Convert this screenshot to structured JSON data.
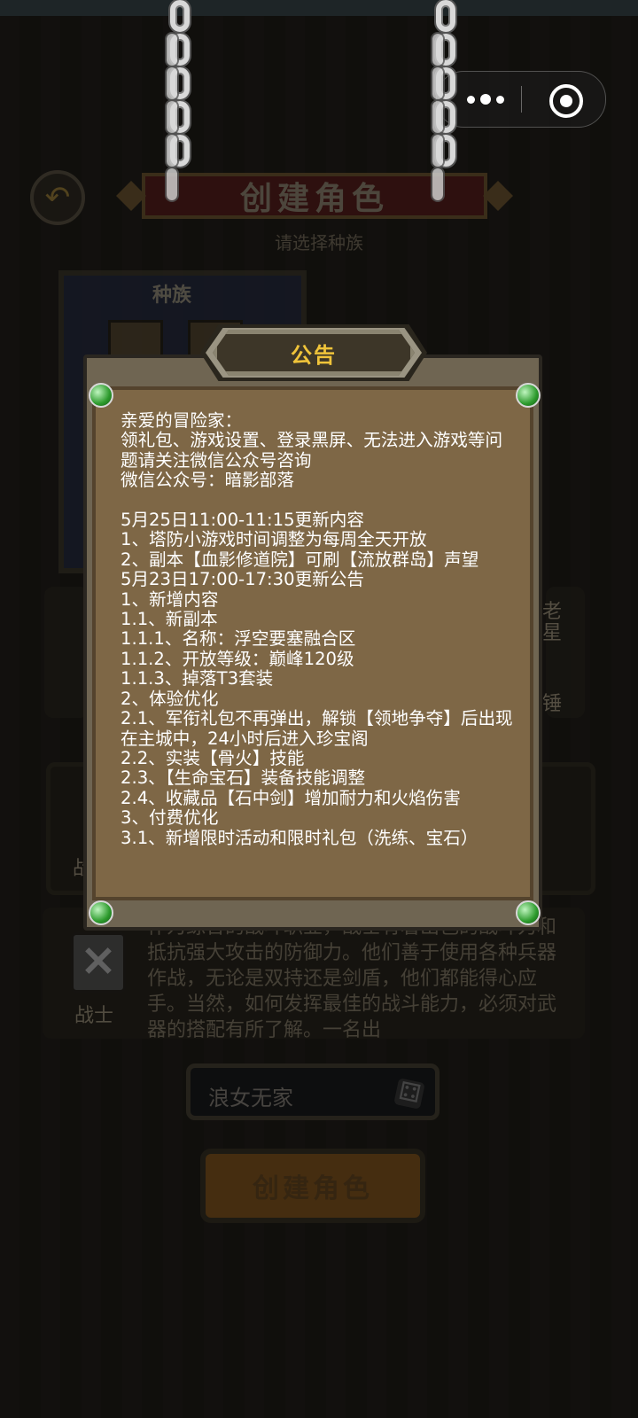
{
  "screen": {
    "title": "创建角色",
    "subtitle": "请选择种族",
    "race_banner_title": "种族",
    "side_right_top": "老",
    "side_right_mid": "星",
    "side_right_bottom": "锤",
    "class_label": "战",
    "warrior_label": "战士",
    "description": "作为综合的战斗职业，战士有着出色的战斗力和抵抗强大攻击的防御力。他们善于使用各种兵器作战，无论是双持还是剑盾，他们都能得心应手。当然，如何发挥最佳的战斗能力，必须对武器的搭配有所了解。一名出",
    "name_value": "浪女无家",
    "create_button": "创建角色"
  },
  "icons": {
    "back": "undo-arrow-icon",
    "more": "more-dots-icon",
    "close": "target-close-icon",
    "dice": "dice-icon",
    "warrior": "crossed-swords-icon"
  },
  "notice": {
    "title": "公告",
    "body": "亲爱的冒险家：\n领礼包、游戏设置、登录黑屏、无法进入游戏等问题请关注微信公众号咨询\n微信公众号：暗影部落\n\n5月25日11:00-11:15更新内容\n1、塔防小游戏时间调整为每周全天开放\n2、副本【血影修道院】可刷【流放群岛】声望\n5月23日17:00-17:30更新公告\n1、新增内容\n1.1、新副本\n1.1.1、名称：浮空要塞融合区\n1.1.2、开放等级：巅峰120级\n1.1.3、掉落T3套装\n2、体验优化\n2.1、军衔礼包不再弹出，解锁【领地争夺】后出现在主城中，24小时后进入珍宝阁\n2.2、实装【骨火】技能\n2.3、【生命宝石】装备技能调整\n2.4、收藏品【石中剑】增加耐力和火焰伤害\n3、付费优化\n3.1、新增限时活动和限时礼包（洗练、宝石）"
  },
  "colors": {
    "notice_paper": "#7e6746",
    "notice_title": "#f0c43a",
    "gem": "#2c9a2c"
  }
}
